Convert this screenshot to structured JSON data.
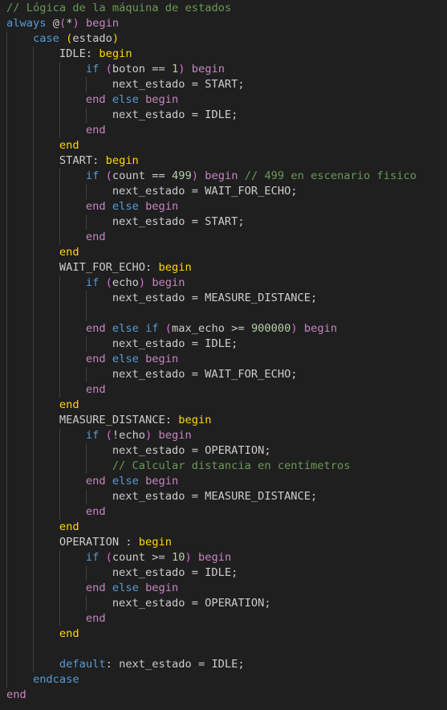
{
  "colors": {
    "background": "#1f1f1f",
    "comment": "#6a9955",
    "keyword": "#569cd6",
    "control": "#c586c0",
    "bracket_gold": "#ffd700",
    "bracket_orchid": "#da70d6",
    "number": "#b5cea8",
    "text": "#cccccc"
  },
  "lines": [
    {
      "indent": 0,
      "tokens": [
        [
          "c",
          "// Lógica de la máquina de estados"
        ]
      ]
    },
    {
      "indent": 0,
      "tokens": [
        [
          "k",
          "always"
        ],
        [
          "t",
          " @"
        ],
        [
          "b1",
          "("
        ],
        [
          "t",
          "*"
        ],
        [
          "b1",
          ")"
        ],
        [
          "t",
          " "
        ],
        [
          "p",
          "begin"
        ]
      ]
    },
    {
      "indent": 1,
      "tokens": [
        [
          "k",
          "case"
        ],
        [
          "t",
          " "
        ],
        [
          "b2",
          "("
        ],
        [
          "t",
          "estado"
        ],
        [
          "b2",
          ")"
        ]
      ]
    },
    {
      "indent": 2,
      "tokens": [
        [
          "t",
          "IDLE: "
        ],
        [
          "y",
          "begin"
        ]
      ]
    },
    {
      "indent": 3,
      "tokens": [
        [
          "k",
          "if"
        ],
        [
          "t",
          " "
        ],
        [
          "b1",
          "("
        ],
        [
          "t",
          "boton == "
        ],
        [
          "n",
          "1"
        ],
        [
          "b1",
          ")"
        ],
        [
          "t",
          " "
        ],
        [
          "p",
          "begin"
        ]
      ]
    },
    {
      "indent": 4,
      "tokens": [
        [
          "t",
          "next_estado = START;"
        ]
      ]
    },
    {
      "indent": 3,
      "tokens": [
        [
          "p",
          "end"
        ],
        [
          "t",
          " "
        ],
        [
          "k",
          "else"
        ],
        [
          "t",
          " "
        ],
        [
          "p",
          "begin"
        ]
      ]
    },
    {
      "indent": 4,
      "tokens": [
        [
          "t",
          "next_estado = IDLE;"
        ]
      ]
    },
    {
      "indent": 3,
      "tokens": [
        [
          "p",
          "end"
        ]
      ]
    },
    {
      "indent": 2,
      "tokens": [
        [
          "y",
          "end"
        ]
      ]
    },
    {
      "indent": 2,
      "tokens": [
        [
          "t",
          "START: "
        ],
        [
          "y",
          "begin"
        ]
      ]
    },
    {
      "indent": 3,
      "tokens": [
        [
          "k",
          "if"
        ],
        [
          "t",
          " "
        ],
        [
          "b1",
          "("
        ],
        [
          "t",
          "count == "
        ],
        [
          "n",
          "499"
        ],
        [
          "b1",
          ")"
        ],
        [
          "t",
          " "
        ],
        [
          "p",
          "begin"
        ],
        [
          "t",
          " "
        ],
        [
          "c",
          "// 499 en escenario fisico"
        ]
      ]
    },
    {
      "indent": 4,
      "tokens": [
        [
          "t",
          "next_estado = WAIT_FOR_ECHO;"
        ]
      ]
    },
    {
      "indent": 3,
      "tokens": [
        [
          "p",
          "end"
        ],
        [
          "t",
          " "
        ],
        [
          "k",
          "else"
        ],
        [
          "t",
          " "
        ],
        [
          "p",
          "begin"
        ]
      ]
    },
    {
      "indent": 4,
      "tokens": [
        [
          "t",
          "next_estado = START;"
        ]
      ]
    },
    {
      "indent": 3,
      "tokens": [
        [
          "p",
          "end"
        ]
      ]
    },
    {
      "indent": 2,
      "tokens": [
        [
          "y",
          "end"
        ]
      ]
    },
    {
      "indent": 2,
      "tokens": [
        [
          "t",
          "WAIT_FOR_ECHO: "
        ],
        [
          "y",
          "begin"
        ]
      ]
    },
    {
      "indent": 3,
      "tokens": [
        [
          "k",
          "if"
        ],
        [
          "t",
          " "
        ],
        [
          "b1",
          "("
        ],
        [
          "t",
          "echo"
        ],
        [
          "b1",
          ")"
        ],
        [
          "t",
          " "
        ],
        [
          "p",
          "begin"
        ]
      ]
    },
    {
      "indent": 4,
      "tokens": [
        [
          "t",
          "next_estado = MEASURE_DISTANCE;"
        ]
      ]
    },
    {
      "indent": 4,
      "tokens": []
    },
    {
      "indent": 3,
      "tokens": [
        [
          "p",
          "end"
        ],
        [
          "t",
          " "
        ],
        [
          "k",
          "else"
        ],
        [
          "t",
          " "
        ],
        [
          "k",
          "if"
        ],
        [
          "t",
          " "
        ],
        [
          "b1",
          "("
        ],
        [
          "t",
          "max_echo >= "
        ],
        [
          "n",
          "900000"
        ],
        [
          "b1",
          ")"
        ],
        [
          "t",
          " "
        ],
        [
          "p",
          "begin"
        ]
      ]
    },
    {
      "indent": 4,
      "tokens": [
        [
          "t",
          "next_estado = IDLE;"
        ]
      ]
    },
    {
      "indent": 3,
      "tokens": [
        [
          "p",
          "end"
        ],
        [
          "t",
          " "
        ],
        [
          "k",
          "else"
        ],
        [
          "t",
          " "
        ],
        [
          "p",
          "begin"
        ]
      ]
    },
    {
      "indent": 4,
      "tokens": [
        [
          "t",
          "next_estado = WAIT_FOR_ECHO;"
        ]
      ]
    },
    {
      "indent": 3,
      "tokens": [
        [
          "p",
          "end"
        ]
      ]
    },
    {
      "indent": 2,
      "tokens": [
        [
          "y",
          "end"
        ]
      ]
    },
    {
      "indent": 2,
      "tokens": [
        [
          "t",
          "MEASURE_DISTANCE: "
        ],
        [
          "y",
          "begin"
        ]
      ]
    },
    {
      "indent": 3,
      "tokens": [
        [
          "k",
          "if"
        ],
        [
          "t",
          " "
        ],
        [
          "b1",
          "("
        ],
        [
          "t",
          "!echo"
        ],
        [
          "b1",
          ")"
        ],
        [
          "t",
          " "
        ],
        [
          "p",
          "begin"
        ]
      ]
    },
    {
      "indent": 4,
      "tokens": [
        [
          "t",
          "next_estado = OPERATION;"
        ]
      ]
    },
    {
      "indent": 4,
      "tokens": [
        [
          "c",
          "// Calcular distancia en centímetros"
        ]
      ]
    },
    {
      "indent": 3,
      "tokens": [
        [
          "p",
          "end"
        ],
        [
          "t",
          " "
        ],
        [
          "k",
          "else"
        ],
        [
          "t",
          " "
        ],
        [
          "p",
          "begin"
        ]
      ]
    },
    {
      "indent": 4,
      "tokens": [
        [
          "t",
          "next_estado = MEASURE_DISTANCE;"
        ]
      ]
    },
    {
      "indent": 3,
      "tokens": [
        [
          "p",
          "end"
        ]
      ]
    },
    {
      "indent": 2,
      "tokens": [
        [
          "y",
          "end"
        ]
      ]
    },
    {
      "indent": 2,
      "tokens": [
        [
          "t",
          "OPERATION : "
        ],
        [
          "y",
          "begin"
        ]
      ]
    },
    {
      "indent": 3,
      "tokens": [
        [
          "k",
          "if"
        ],
        [
          "t",
          " "
        ],
        [
          "b1",
          "("
        ],
        [
          "t",
          "count >= "
        ],
        [
          "n",
          "10"
        ],
        [
          "b1",
          ")"
        ],
        [
          "t",
          " "
        ],
        [
          "p",
          "begin"
        ]
      ]
    },
    {
      "indent": 4,
      "tokens": [
        [
          "t",
          "next_estado = IDLE;"
        ]
      ]
    },
    {
      "indent": 3,
      "tokens": [
        [
          "p",
          "end"
        ],
        [
          "t",
          " "
        ],
        [
          "k",
          "else"
        ],
        [
          "t",
          " "
        ],
        [
          "p",
          "begin"
        ]
      ]
    },
    {
      "indent": 4,
      "tokens": [
        [
          "t",
          "next_estado = OPERATION;"
        ]
      ]
    },
    {
      "indent": 3,
      "tokens": [
        [
          "p",
          "end"
        ]
      ]
    },
    {
      "indent": 2,
      "tokens": [
        [
          "y",
          "end"
        ]
      ]
    },
    {
      "indent": 2,
      "tokens": []
    },
    {
      "indent": 2,
      "tokens": [
        [
          "k",
          "default"
        ],
        [
          "t",
          ": next_estado = IDLE;"
        ]
      ]
    },
    {
      "indent": 1,
      "tokens": [
        [
          "k",
          "endcase"
        ]
      ]
    },
    {
      "indent": 0,
      "tokens": [
        [
          "p",
          "end"
        ]
      ]
    }
  ]
}
